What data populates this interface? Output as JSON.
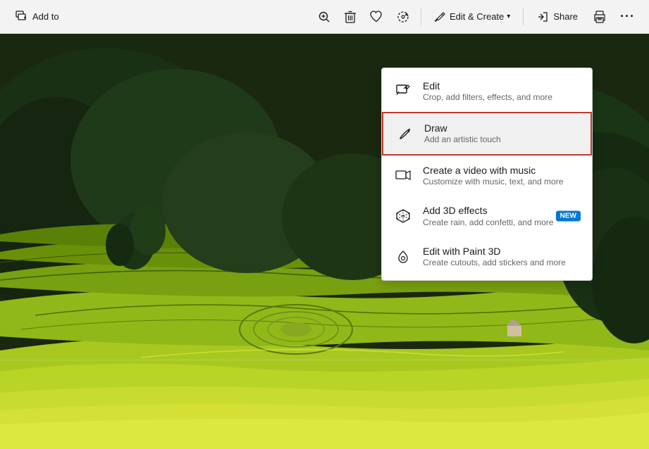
{
  "toolbar": {
    "add_to_label": "Add to",
    "share_label": "Share",
    "edit_create_label": "Edit & Create",
    "icons": {
      "add_to": "🖼",
      "zoom": "🔍",
      "delete": "🗑",
      "favorite": "♡",
      "rotate": "↺",
      "edit_create": "✂",
      "share": "↗",
      "print": "🖨",
      "more": "•••"
    }
  },
  "dropdown": {
    "items": [
      {
        "id": "edit",
        "title": "Edit",
        "subtitle": "Crop, add filters, effects, and more",
        "highlighted": false,
        "icon": "edit"
      },
      {
        "id": "draw",
        "title": "Draw",
        "subtitle": "Add an artistic touch",
        "highlighted": true,
        "icon": "draw"
      },
      {
        "id": "create-video",
        "title": "Create a video with music",
        "subtitle": "Customize with music, text, and more",
        "highlighted": false,
        "icon": "video"
      },
      {
        "id": "add-3d",
        "title": "Add 3D effects",
        "subtitle": "Create rain, add confetti, and more",
        "highlighted": false,
        "badge": "NEW",
        "icon": "3d"
      },
      {
        "id": "paint-3d",
        "title": "Edit with Paint 3D",
        "subtitle": "Create cutouts, add stickers and more",
        "highlighted": false,
        "icon": "paint3d"
      }
    ]
  }
}
